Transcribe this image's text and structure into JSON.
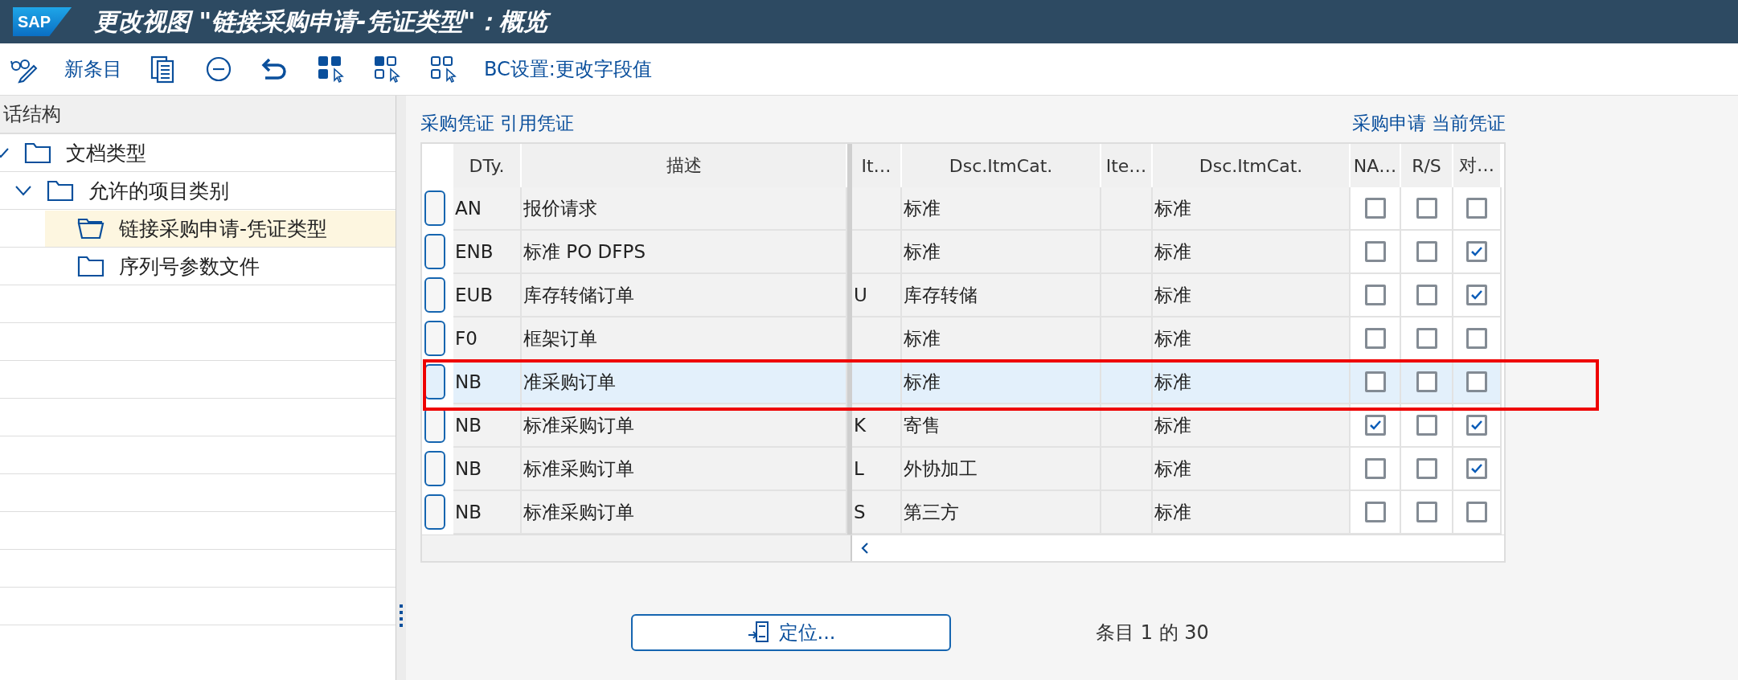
{
  "window": {
    "logo": "SAP",
    "title": "更改视图 \"链接采购申请-凭证类型\"：概览"
  },
  "toolbar": [
    {
      "kind": "glasses-pencil"
    },
    {
      "kind": "text",
      "label": "新条目"
    },
    {
      "kind": "documents"
    },
    {
      "kind": "minus-circle"
    },
    {
      "kind": "undo"
    },
    {
      "kind": "select-all"
    },
    {
      "kind": "select-block"
    },
    {
      "kind": "deselect-all"
    },
    {
      "kind": "text",
      "label": "BC设置:更改字段值"
    }
  ],
  "sidebar": {
    "header": "话结构",
    "items": [
      {
        "label": "文档类型",
        "expanded": true,
        "selected": false,
        "children": [
          {
            "label": "允许的项目类别",
            "expanded": true,
            "selected": false,
            "children": [
              {
                "label": "链接采购申请-凭证类型",
                "selected": true
              },
              {
                "label": "序列号参数文件",
                "selected": false
              }
            ]
          }
        ]
      }
    ]
  },
  "table": {
    "left_group": "采购凭证 引用凭证",
    "right_group": "采购申请 当前凭证",
    "columns": [
      "DTy.",
      "描述",
      "It…",
      "Dsc.ItmCat.",
      "Ite…",
      "Dsc.ItmCat.",
      "NA…",
      "R/S",
      "对…"
    ],
    "rows": [
      {
        "selected": false,
        "annotated": false,
        "dty": "AN",
        "desc": "报价请求",
        "item_cat": "",
        "ref_desc": "标准",
        "cur_desc": "标准",
        "na": false,
        "rs": false,
        "flag": false
      },
      {
        "selected": false,
        "annotated": false,
        "dty": "ENB",
        "desc": "标准 PO DFPS",
        "item_cat": "",
        "ref_desc": "标准",
        "cur_desc": "标准",
        "na": false,
        "rs": false,
        "flag": true
      },
      {
        "selected": false,
        "annotated": false,
        "dty": "EUB",
        "desc": "库存转储订单",
        "item_cat": "U",
        "ref_desc": "库存转储",
        "cur_desc": "标准",
        "na": false,
        "rs": false,
        "flag": true
      },
      {
        "selected": false,
        "annotated": false,
        "dty": "F0",
        "desc": "框架订单",
        "item_cat": "",
        "ref_desc": "标准",
        "cur_desc": "标准",
        "na": false,
        "rs": false,
        "flag": false
      },
      {
        "selected": true,
        "annotated": true,
        "dty": "NB",
        "desc": "准采购订单",
        "item_cat": "",
        "ref_desc": "标准",
        "cur_desc": "标准",
        "na": false,
        "rs": false,
        "flag": false
      },
      {
        "selected": false,
        "annotated": false,
        "dty": "NB",
        "desc": "标准采购订单",
        "item_cat": "K",
        "ref_desc": "寄售",
        "cur_desc": "标准",
        "na": true,
        "rs": false,
        "flag": true
      },
      {
        "selected": false,
        "annotated": false,
        "dty": "NB",
        "desc": "标准采购订单",
        "item_cat": "L",
        "ref_desc": "外协加工",
        "cur_desc": "标准",
        "na": false,
        "rs": false,
        "flag": true
      },
      {
        "selected": false,
        "annotated": false,
        "dty": "NB",
        "desc": "标准采购订单",
        "item_cat": "S",
        "ref_desc": "第三方",
        "cur_desc": "标准",
        "na": false,
        "rs": false,
        "flag": false
      }
    ]
  },
  "footer": {
    "button": "定位...",
    "count": "条目 1 的 30"
  }
}
